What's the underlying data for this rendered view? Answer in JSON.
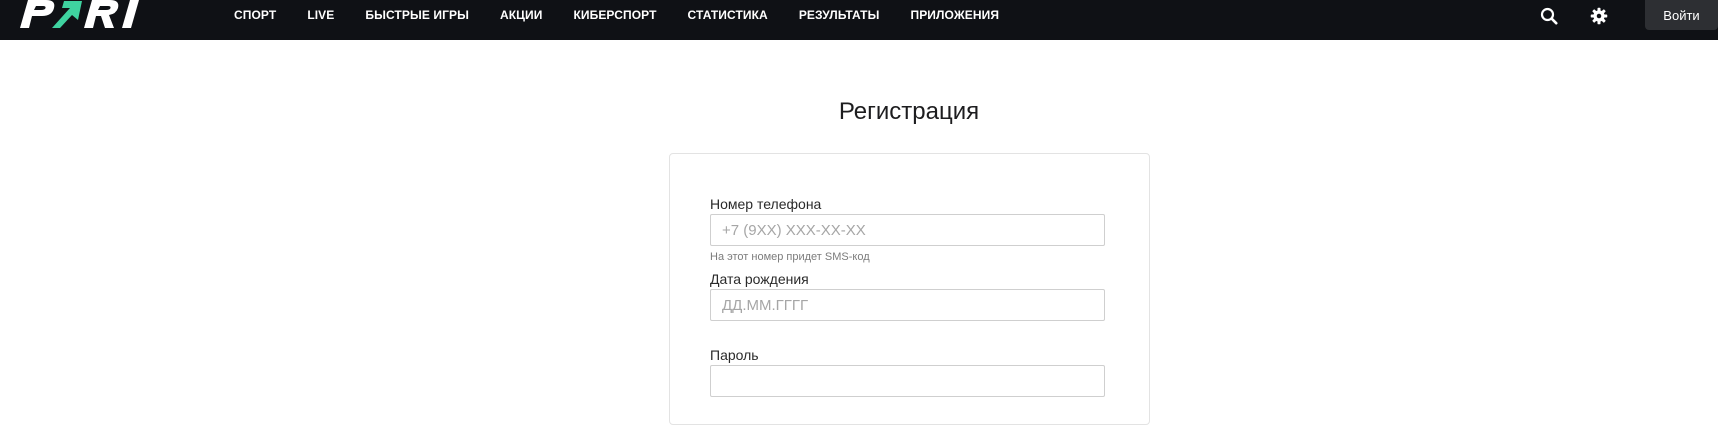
{
  "header": {
    "logo_text": "PARI",
    "nav": [
      {
        "label": "СПОРТ"
      },
      {
        "label": "LIVE"
      },
      {
        "label": "БЫСТРЫЕ ИГРЫ"
      },
      {
        "label": "АКЦИИ"
      },
      {
        "label": "КИБЕРСПОРТ"
      },
      {
        "label": "СТАТИСТИКА"
      },
      {
        "label": "РЕЗУЛЬТАТЫ"
      },
      {
        "label": "ПРИЛОЖЕНИЯ"
      }
    ],
    "search_icon": "search-icon",
    "settings_icon": "gear-icon",
    "login_label": "Войти"
  },
  "main": {
    "title": "Регистрация",
    "form": {
      "phone": {
        "label": "Номер телефона",
        "placeholder": "+7 (9XX) XXX-XX-XX",
        "value": "",
        "hint": "На этот номер придет SMS-код"
      },
      "birthdate": {
        "label": "Дата рождения",
        "placeholder": "ДД.ММ.ГГГГ",
        "value": ""
      },
      "password": {
        "label": "Пароль",
        "placeholder": "",
        "value": ""
      }
    }
  },
  "colors": {
    "header_bg": "#0f1115",
    "accent": "#3fd3a0",
    "login_bg": "#2d2f33"
  }
}
